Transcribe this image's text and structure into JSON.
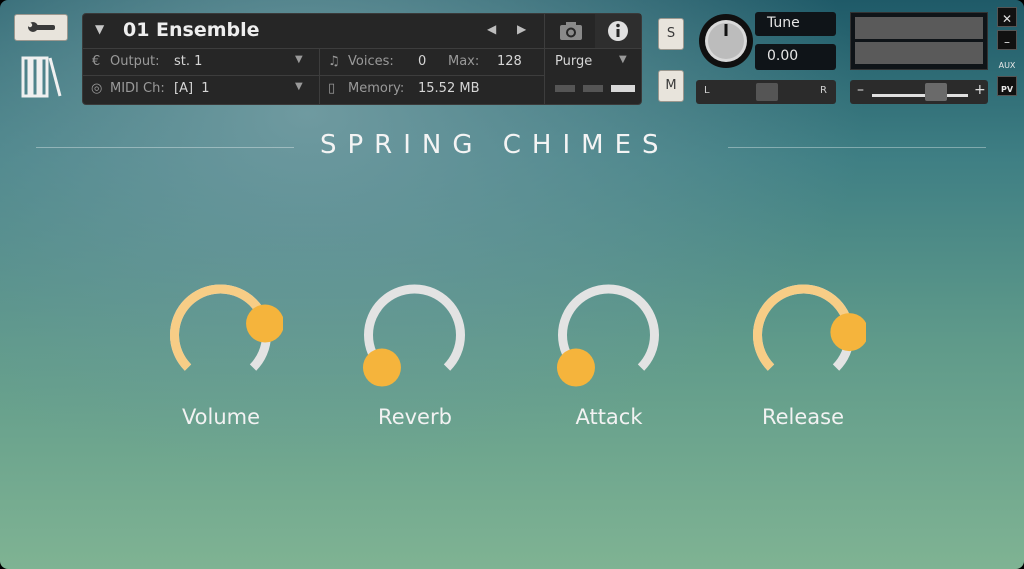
{
  "header": {
    "instrument_name": "01 Ensemble",
    "output_label": "Output:",
    "output_value": "st. 1",
    "midi_label": "MIDI Ch:",
    "midi_value": "[A]  1",
    "voices_label": "Voices:",
    "voices_value": "0",
    "max_label": "Max:",
    "max_value": "128",
    "memory_label": "Memory:",
    "memory_value": "15.52 MB",
    "purge_label": "Purge",
    "solo_label": "S",
    "mute_label": "M",
    "tune_label": "Tune",
    "tune_value": "0.00",
    "pan_left": "L",
    "pan_right": "R",
    "vol_minus": "–",
    "vol_plus": "+",
    "close_label": "✕",
    "minimize_label": "–",
    "aux_label": "AUX",
    "pv_label": "PV"
  },
  "main": {
    "title": "SPRING CHIMES",
    "knobs": [
      {
        "label": "Volume",
        "value": 0.78
      },
      {
        "label": "Reverb",
        "value": 0.0
      },
      {
        "label": "Attack",
        "value": 0.0
      },
      {
        "label": "Release",
        "value": 0.82
      }
    ]
  },
  "colors": {
    "accent": "#f5b43c",
    "arc_active": "#f7cd86",
    "arc_track": "#e3e3e3"
  }
}
